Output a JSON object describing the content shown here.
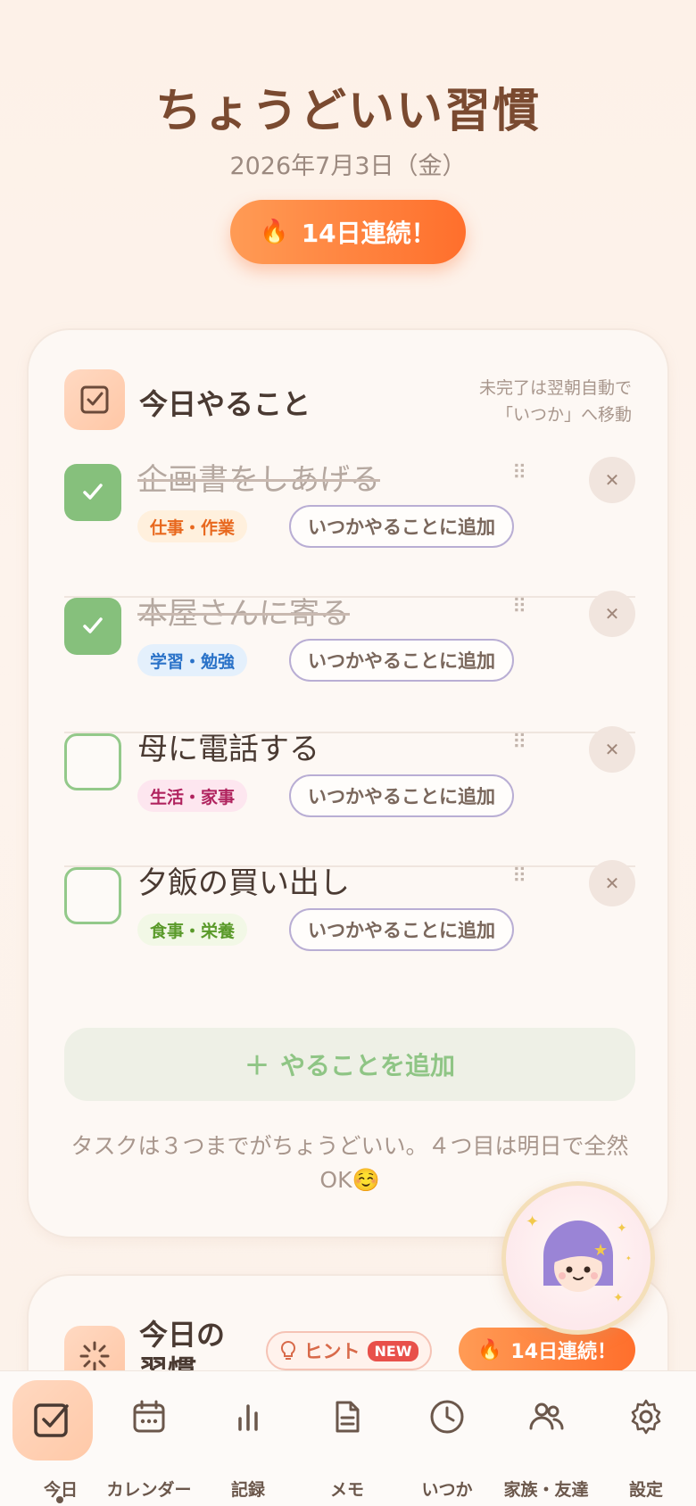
{
  "header": {
    "title": "ちょうどいい習慣",
    "date": "2026年7月3日（金）",
    "streak": "14日連続！",
    "streak_icon": "flame-icon"
  },
  "today_card": {
    "title": "今日やること",
    "note_line1": "未完了は翌朝自動で",
    "note_line2": "「いつか」へ移動",
    "tasks": [
      {
        "title": "企画書をしあげる",
        "done": true,
        "category": "仕事・作業",
        "category_color": "#e8681e",
        "category_bg": "#fff0dd",
        "someday": "いつかやることに追加"
      },
      {
        "title": "本屋さんに寄る",
        "done": true,
        "category": "学習・勉強",
        "category_color": "#2a72c8",
        "category_bg": "#e4f0fc",
        "someday": "いつかやることに追加"
      },
      {
        "title": "母に電話する",
        "done": false,
        "category": "生活・家事",
        "category_color": "#b0235e",
        "category_bg": "#fde6ef",
        "someday": "いつかやることに追加"
      },
      {
        "title": "夕飯の買い出し",
        "done": false,
        "category": "食事・栄養",
        "category_color": "#5a9a2a",
        "category_bg": "#f2f8e6",
        "someday": "いつかやることに追加"
      }
    ],
    "add_label": "やることを追加",
    "tip": "タスクは３つまでがちょうどいい。４つ目は明日で全然OK☺️"
  },
  "habits_card": {
    "title": "今日の習慣",
    "hint": "ヒント",
    "new_badge": "NEW",
    "streak": "14日連続！"
  },
  "nav": {
    "items": [
      {
        "label": "今日",
        "icon": "checkbox-icon",
        "active": true
      },
      {
        "label": "カレンダー",
        "icon": "calendar-icon",
        "active": false
      },
      {
        "label": "記録",
        "icon": "bar-chart-icon",
        "active": false
      },
      {
        "label": "メモ",
        "icon": "document-icon",
        "active": false
      },
      {
        "label": "いつか",
        "icon": "clock-icon",
        "active": false
      },
      {
        "label": "家族・友達",
        "icon": "people-icon",
        "active": false
      },
      {
        "label": "設定",
        "icon": "gear-icon",
        "active": false
      }
    ]
  }
}
